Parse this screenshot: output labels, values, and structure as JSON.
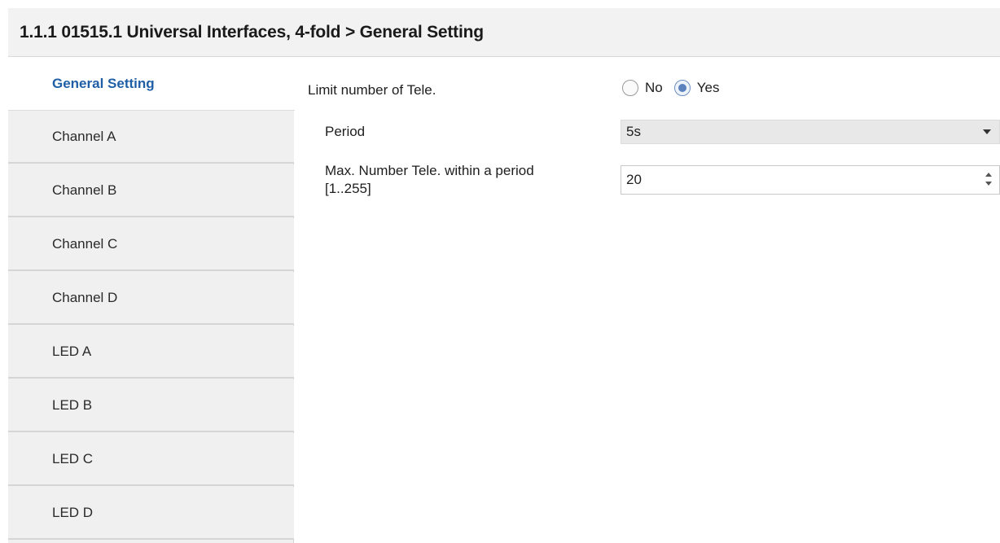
{
  "header": {
    "title": "1.1.1 01515.1 Universal Interfaces, 4-fold > General Setting"
  },
  "sidebar": {
    "items": [
      {
        "label": "General Setting",
        "active": true
      },
      {
        "label": "Channel A",
        "active": false
      },
      {
        "label": "Channel B",
        "active": false
      },
      {
        "label": "Channel C",
        "active": false
      },
      {
        "label": "Channel D",
        "active": false
      },
      {
        "label": "LED A",
        "active": false
      },
      {
        "label": "LED B",
        "active": false
      },
      {
        "label": "LED C",
        "active": false
      },
      {
        "label": "LED D",
        "active": false
      }
    ]
  },
  "settings": {
    "limit_tele": {
      "label": "Limit number of Tele.",
      "options": [
        "No",
        "Yes"
      ],
      "selected": "Yes"
    },
    "period": {
      "label": "Period",
      "value": "5s"
    },
    "max_number": {
      "label_line1": "Max. Number Tele. within a period",
      "label_line2": "[1..255]",
      "value": "20"
    }
  },
  "colors": {
    "accent": "#1f5fa6",
    "header_bg": "#f2f2f2",
    "sidebar_bg": "#f0f0f0",
    "radio_checked": "#5b82bd"
  }
}
